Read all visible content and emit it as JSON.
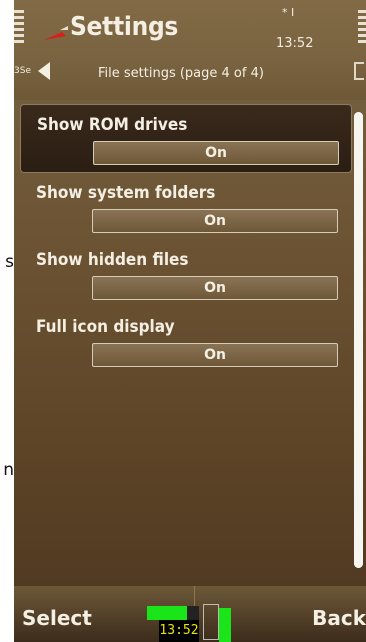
{
  "background_fragments": [
    "s",
    "n"
  ],
  "header": {
    "title": "Settings",
    "time": "13:52",
    "status_icons": "* I"
  },
  "nav": {
    "prefix": "3Se",
    "title": "File settings (page 4 of 4)"
  },
  "settings": [
    {
      "label": "Show ROM drives",
      "value": "On",
      "selected": true
    },
    {
      "label": "Show system folders",
      "value": "On",
      "selected": false
    },
    {
      "label": "Show hidden files",
      "value": "On",
      "selected": false
    },
    {
      "label": "Full icon display",
      "value": "On",
      "selected": false
    }
  ],
  "softkeys": {
    "left": "Select",
    "right": "Back",
    "mini_clock": "13:52"
  },
  "colors": {
    "accent_green": "#19e519",
    "text": "#f4efe3",
    "selection_bg": "#2a1d12"
  }
}
